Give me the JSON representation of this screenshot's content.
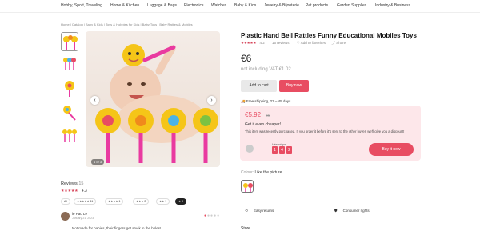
{
  "nav": {
    "items": [
      "Hobby, Sport, Traveling",
      "Home & Kitchen",
      "Luggage & Bags",
      "Electronics",
      "Watches",
      "Baby & Kids",
      "Jewelry & Bijouterie",
      "Pet products",
      "Garden Supplies",
      "Industry & Business"
    ]
  },
  "breadcrumb": "Home  |  Catalog  |  Baby & Kids  |  Toys & Hobbies for Kids  |  Baby Toys  |  Baby Rattles & Mobiles",
  "gallery": {
    "counter": "1 of 3",
    "prev_icon": "chevron-left-icon",
    "next_icon": "chevron-right-icon"
  },
  "product": {
    "title": "Plastic Hand Bell Rattles Funny Educational Mobiles Toys",
    "rating_stars": "★★★★★",
    "rating": "4.2",
    "reviews_link": "15 reviews",
    "favorites": "♡ Add to favorites",
    "share": "⤴ Share",
    "price": "€6",
    "vat_note": "not including VAT €1.02",
    "add_to_cart": "Add to cart",
    "buy_now": "Buy now",
    "shipping": "🚚 Free shipping, 23 – 45 days"
  },
  "offer": {
    "price": "€5.92",
    "old_price": "€6",
    "headline": "Get it even cheaper!",
    "text": "This item was recently purchased. If you order it before it's sent to the other buyer, we'll give you a discount!",
    "buyer_name": "Véronique",
    "timer": [
      "1",
      "4",
      "2"
    ],
    "button": "Buy it now"
  },
  "colour": {
    "label": "Colour:",
    "value": "Like the picture"
  },
  "features": {
    "returns": "Easy returns",
    "rights": "Consumer rights"
  },
  "store": "Store",
  "reviews": {
    "title": "Reviews",
    "count": "15",
    "stars": "★★★★★",
    "average": "4.3",
    "filters": [
      "All",
      "★★★★★ 11",
      "★★★★ 1",
      "★★★ 2",
      "★★ 1",
      "★ 0"
    ],
    "pager_dots": "●●●●",
    "reviewer": "le Pao Le",
    "date": "January 21, 2023",
    "text": "Not made for babies, their fingers get stuck in the holes!"
  },
  "colors": {
    "accent": "#e84d62",
    "offer_bg": "#fde7ea"
  }
}
